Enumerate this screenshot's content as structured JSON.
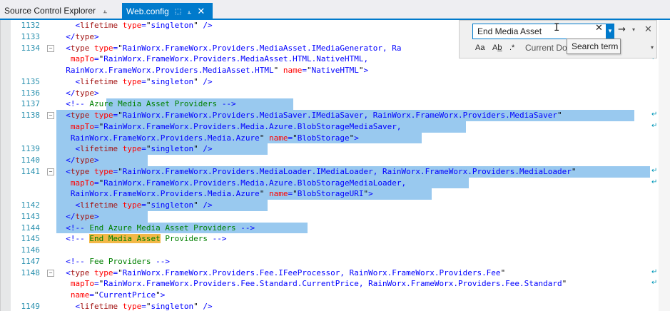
{
  "tabs": [
    {
      "label": "Source Control Explorer",
      "active": false
    },
    {
      "label": "Web.config",
      "active": true
    }
  ],
  "find": {
    "value": "End Media Asset",
    "scope": "Current Do",
    "tooltip": "Search term",
    "opt_case": "Aa",
    "opt_word": "Ab̲",
    "opt_regex": ".*"
  },
  "editor": {
    "lines": [
      {
        "num": "1132",
        "fold": false,
        "wrap": false,
        "sel": null,
        "html": "    <span class=\"t-b\">&lt;</span><span class=\"t-m\">lifetime</span> <span class=\"t-a\">type</span><span class=\"t-b\">=</span><span class=\"t-t\">\"</span><span class=\"t-v\">singleton</span><span class=\"t-t\">\"</span> <span class=\"t-b\">/&gt;</span>"
      },
      {
        "num": "1133",
        "fold": false,
        "wrap": false,
        "sel": null,
        "html": "  <span class=\"t-b\">&lt;/</span><span class=\"t-m\">type</span><span class=\"t-b\">&gt;</span>"
      },
      {
        "num": "1134",
        "fold": true,
        "wrap": true,
        "sel": null,
        "html": "  <span class=\"t-b\">&lt;</span><span class=\"t-m\">type</span> <span class=\"t-a\">type</span><span class=\"t-b\">=</span><span class=\"t-t\">\"</span><span class=\"t-v\">RainWorx.FrameWorx.Providers.MediaAsset.IMediaGenerator, Ra</span>"
      },
      {
        "num": "",
        "fold": false,
        "wrap": true,
        "sel": null,
        "html": "   <span class=\"t-a\">mapTo</span><span class=\"t-b\">=</span><span class=\"t-t\">\"</span><span class=\"t-v\">RainWorx.FrameWorx.Providers.MediaAsset.HTML.NativeHTML,</span>"
      },
      {
        "num": "",
        "fold": false,
        "wrap": false,
        "sel": null,
        "html": "  <span class=\"t-v\">RainWorx.FrameWorx.Providers.MediaAsset.HTML</span><span class=\"t-t\">\"</span> <span class=\"t-a\">name</span><span class=\"t-b\">=</span><span class=\"t-t\">\"</span><span class=\"t-v\">NativeHTML</span><span class=\"t-t\">\"</span><span class=\"t-b\">&gt;</span>"
      },
      {
        "num": "1135",
        "fold": false,
        "wrap": false,
        "sel": null,
        "html": "    <span class=\"t-b\">&lt;</span><span class=\"t-m\">lifetime</span> <span class=\"t-a\">type</span><span class=\"t-b\">=</span><span class=\"t-t\">\"</span><span class=\"t-v\">singleton</span><span class=\"t-t\">\"</span> <span class=\"t-b\">/&gt;</span>"
      },
      {
        "num": "1136",
        "fold": false,
        "wrap": false,
        "sel": null,
        "html": "  <span class=\"t-b\">&lt;/</span><span class=\"t-m\">type</span><span class=\"t-b\">&gt;</span>"
      },
      {
        "num": "1137",
        "fold": false,
        "wrap": false,
        "sel": [
          70,
          332
        ],
        "html": "  <span class=\"t-b\">&lt;!--</span><span class=\"t-c\"> Azure Media Asset Providers </span><span class=\"t-b\">--&gt;</span>"
      },
      {
        "num": "1138",
        "fold": true,
        "wrap": true,
        "sel": [
          0,
          810
        ],
        "html": "  <span class=\"t-b\">&lt;</span><span class=\"t-m\">type</span> <span class=\"t-a\">type</span><span class=\"t-b\">=</span><span class=\"t-t\">\"</span><span class=\"t-v\">RainWorx.FrameWorx.Providers.MediaSaver.IMediaSaver, RainWorx.FrameWorx.Providers.MediaSaver</span><span class=\"t-t\">\"</span>"
      },
      {
        "num": "",
        "fold": false,
        "wrap": true,
        "sel": [
          0,
          574
        ],
        "html": "   <span class=\"t-a\">mapTo</span><span class=\"t-b\">=</span><span class=\"t-t\">\"</span><span class=\"t-v\">RainWorx.FrameWorx.Providers.Media.Azure.BlobStorageMediaSaver,</span>"
      },
      {
        "num": "",
        "fold": false,
        "wrap": false,
        "sel": [
          0,
          512
        ],
        "html": "   <span class=\"t-v\">RainWorx.FrameWorx.Providers.Media.Azure</span><span class=\"t-t\">\"</span> <span class=\"t-a\">name</span><span class=\"t-b\">=</span><span class=\"t-t\">\"</span><span class=\"t-v\">BlobStorage</span><span class=\"t-t\">\"</span><span class=\"t-b\">&gt;</span>"
      },
      {
        "num": "1139",
        "fold": false,
        "wrap": false,
        "sel": [
          0,
          296
        ],
        "html": "    <span class=\"t-b\">&lt;</span><span class=\"t-m\">lifetime</span> <span class=\"t-a\">type</span><span class=\"t-b\">=</span><span class=\"t-t\">\"</span><span class=\"t-v\">singleton</span><span class=\"t-t\">\"</span> <span class=\"t-b\">/&gt;</span>"
      },
      {
        "num": "1140",
        "fold": false,
        "wrap": false,
        "sel": [
          0,
          128
        ],
        "html": "  <span class=\"t-b\">&lt;/</span><span class=\"t-m\">type</span><span class=\"t-b\">&gt;</span>"
      },
      {
        "num": "1141",
        "fold": true,
        "wrap": true,
        "sel": [
          0,
          832
        ],
        "html": "  <span class=\"t-b\">&lt;</span><span class=\"t-m\">type</span> <span class=\"t-a\">type</span><span class=\"t-b\">=</span><span class=\"t-t\">\"</span><span class=\"t-v\">RainWorx.FrameWorx.Providers.MediaLoader.IMediaLoader, RainWorx.FrameWorx.Providers.MediaLoader</span><span class=\"t-t\">\"</span>"
      },
      {
        "num": "",
        "fold": false,
        "wrap": true,
        "sel": [
          0,
          578
        ],
        "html": "   <span class=\"t-a\">mapTo</span><span class=\"t-b\">=</span><span class=\"t-t\">\"</span><span class=\"t-v\">RainWorx.FrameWorx.Providers.Media.Azure.BlobStorageMediaLoader,</span>"
      },
      {
        "num": "",
        "fold": false,
        "wrap": false,
        "sel": [
          0,
          526
        ],
        "html": "   <span class=\"t-v\">RainWorx.FrameWorx.Providers.Media.Azure</span><span class=\"t-t\">\"</span> <span class=\"t-a\">name</span><span class=\"t-b\">=</span><span class=\"t-t\">\"</span><span class=\"t-v\">BlobStorageURI</span><span class=\"t-t\">\"</span><span class=\"t-b\">&gt;</span>"
      },
      {
        "num": "1142",
        "fold": false,
        "wrap": false,
        "sel": [
          0,
          296
        ],
        "html": "    <span class=\"t-b\">&lt;</span><span class=\"t-m\">lifetime</span> <span class=\"t-a\">type</span><span class=\"t-b\">=</span><span class=\"t-t\">\"</span><span class=\"t-v\">singleton</span><span class=\"t-t\">\"</span> <span class=\"t-b\">/&gt;</span>"
      },
      {
        "num": "1143",
        "fold": false,
        "wrap": false,
        "sel": [
          0,
          128
        ],
        "html": "  <span class=\"t-b\">&lt;/</span><span class=\"t-m\">type</span><span class=\"t-b\">&gt;</span>"
      },
      {
        "num": "1144",
        "fold": false,
        "wrap": false,
        "sel": [
          0,
          352
        ],
        "html": "  <span class=\"t-b\">&lt;!--</span><span class=\"t-c\"> End Azure Media Asset Providers </span><span class=\"t-b\">--&gt;</span>"
      },
      {
        "num": "1145",
        "fold": false,
        "wrap": false,
        "sel": null,
        "html": "  <span class=\"t-b\">&lt;!--</span><span class=\"t-c\"> <span class=\"hl\">End Media Asset</span> Providers </span><span class=\"t-b\">--&gt;</span>"
      },
      {
        "num": "1146",
        "fold": false,
        "wrap": false,
        "sel": null,
        "html": ""
      },
      {
        "num": "1147",
        "fold": false,
        "wrap": false,
        "sel": null,
        "html": "  <span class=\"t-b\">&lt;!--</span><span class=\"t-c\"> Fee Providers </span><span class=\"t-b\">--&gt;</span>"
      },
      {
        "num": "1148",
        "fold": true,
        "wrap": true,
        "sel": null,
        "html": "  <span class=\"t-b\">&lt;</span><span class=\"t-m\">type</span> <span class=\"t-a\">type</span><span class=\"t-b\">=</span><span class=\"t-t\">\"</span><span class=\"t-v\">RainWorx.FrameWorx.Providers.Fee.IFeeProcessor, RainWorx.FrameWorx.Providers.Fee</span><span class=\"t-t\">\"</span>"
      },
      {
        "num": "",
        "fold": false,
        "wrap": true,
        "sel": null,
        "html": "   <span class=\"t-a\">mapTo</span><span class=\"t-b\">=</span><span class=\"t-t\">\"</span><span class=\"t-v\">RainWorx.FrameWorx.Providers.Fee.Standard.CurrentPrice, RainWorx.FrameWorx.Providers.Fee.Standard</span><span class=\"t-t\">\"</span>"
      },
      {
        "num": "",
        "fold": false,
        "wrap": false,
        "sel": null,
        "html": "   <span class=\"t-a\">name</span><span class=\"t-b\">=</span><span class=\"t-t\">\"</span><span class=\"t-v\">CurrentPrice</span><span class=\"t-t\">\"</span><span class=\"t-b\">&gt;</span>"
      },
      {
        "num": "1149",
        "fold": false,
        "wrap": false,
        "sel": null,
        "html": "    <span class=\"t-b\">&lt;</span><span class=\"t-m\">lifetime</span> <span class=\"t-a\">type</span><span class=\"t-b\">=</span><span class=\"t-t\">\"</span><span class=\"t-v\">singleton</span><span class=\"t-t\">\"</span> <span class=\"t-b\">/&gt;</span>"
      }
    ]
  }
}
